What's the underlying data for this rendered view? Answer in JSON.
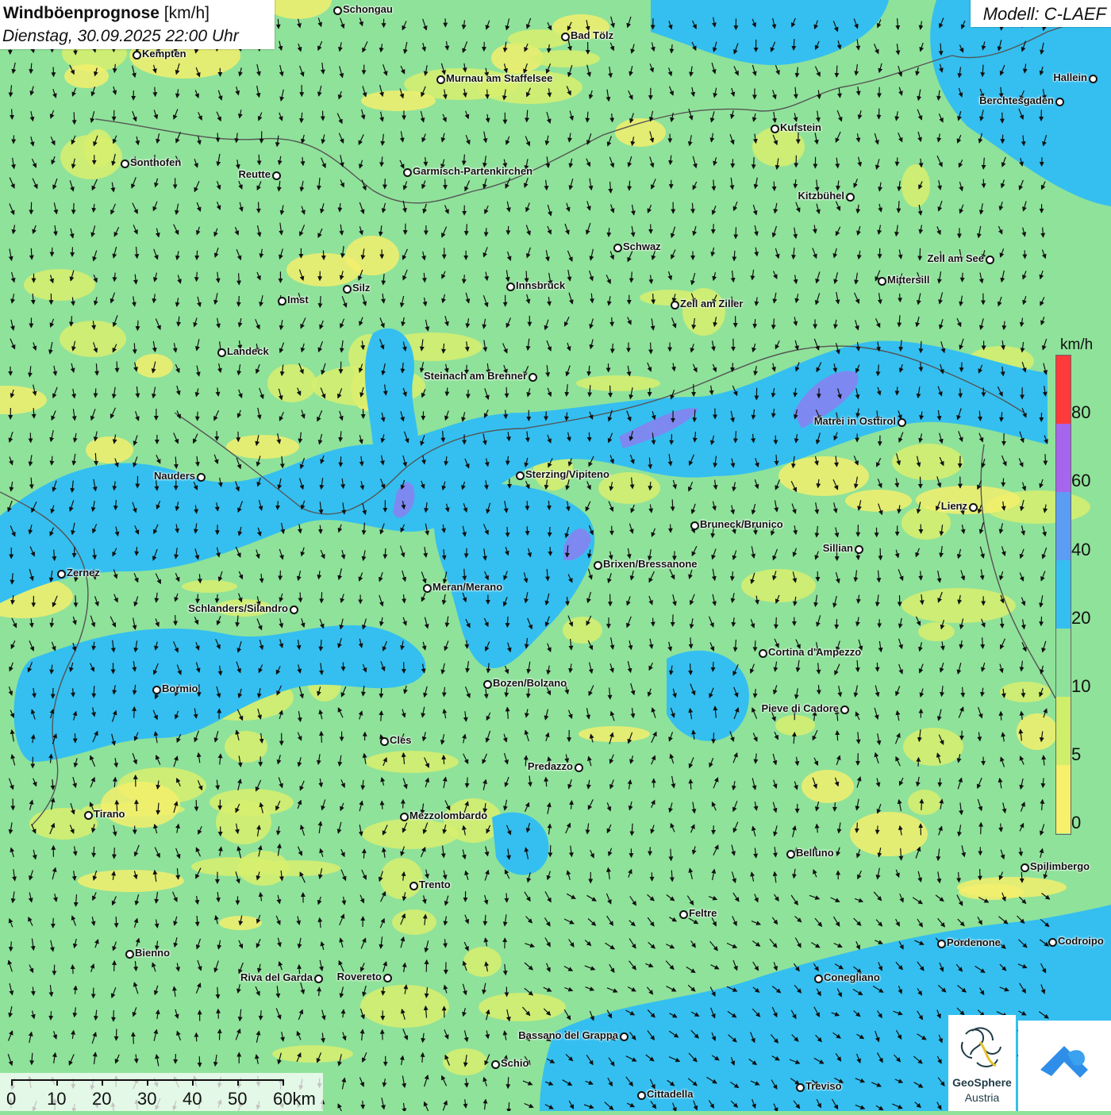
{
  "header": {
    "title_bold": "Windböenprognose",
    "title_unit": " [km/h]",
    "subtitle": "Dienstag, 30.09.2025 22:00 Uhr",
    "model": "Modell: C-LAEF"
  },
  "legend": {
    "unit": "km/h",
    "ticks": [
      "80",
      "60",
      "40",
      "20",
      "10",
      "5",
      "0"
    ],
    "colors": [
      "#ff3a3a",
      "#a565ec",
      "#5b9df2",
      "#34bff0",
      "#8fe29a",
      "#cfee6a",
      "#f6f06a"
    ]
  },
  "cities": [
    {
      "name": "Schongau"
    },
    {
      "name": "Bad Tölz"
    },
    {
      "name": "Kempten"
    },
    {
      "name": "Hallein"
    },
    {
      "name": "Murnau am Staffelsee"
    },
    {
      "name": "Berchtesgaden"
    },
    {
      "name": "Kufstein"
    },
    {
      "name": "Sonthofen"
    },
    {
      "name": "Reutte"
    },
    {
      "name": "Garmisch-Partenkirchen"
    },
    {
      "name": "Kitzbühel"
    },
    {
      "name": "Schwaz"
    },
    {
      "name": "Zell am See"
    },
    {
      "name": "Innsbruck"
    },
    {
      "name": "Mittersill"
    },
    {
      "name": "Silz"
    },
    {
      "name": "Imst"
    },
    {
      "name": "Zell am Ziller"
    },
    {
      "name": "Landeck"
    },
    {
      "name": "Steinach am Brenner"
    },
    {
      "name": "Matrei in Osttirol"
    },
    {
      "name": "Nauders"
    },
    {
      "name": "Sterzing/Vipiteno"
    },
    {
      "name": "Lienz"
    },
    {
      "name": "Bruneck/Brunico"
    },
    {
      "name": "Sillian"
    },
    {
      "name": "Brixen/Bressanone"
    },
    {
      "name": "Zernez"
    },
    {
      "name": "Meran/Merano"
    },
    {
      "name": "Schlanders/Silandro"
    },
    {
      "name": "Cortina d'Ampezzo"
    },
    {
      "name": "Bozen/Bolzano"
    },
    {
      "name": "Pieve di Cadore"
    },
    {
      "name": "Bormio"
    },
    {
      "name": "Cles"
    },
    {
      "name": "Predazzo"
    },
    {
      "name": "Tirano"
    },
    {
      "name": "Mezzolombardo"
    },
    {
      "name": "Belluno"
    },
    {
      "name": "Spilimbergo"
    },
    {
      "name": "Trento"
    },
    {
      "name": "Feltre"
    },
    {
      "name": "Pordenone"
    },
    {
      "name": "Codroipo"
    },
    {
      "name": "Bienno"
    },
    {
      "name": "Riva del Garda"
    },
    {
      "name": "Rovereto"
    },
    {
      "name": "Conegliano"
    },
    {
      "name": "Bassano del Grappa"
    },
    {
      "name": "Schio"
    },
    {
      "name": "Treviso"
    },
    {
      "name": "Cittadella"
    }
  ],
  "scale": {
    "labels": [
      "0",
      "10",
      "20",
      "30",
      "40",
      "50",
      "60km"
    ]
  },
  "logo": {
    "line1": "GeoSphere",
    "line2": "Austria"
  }
}
